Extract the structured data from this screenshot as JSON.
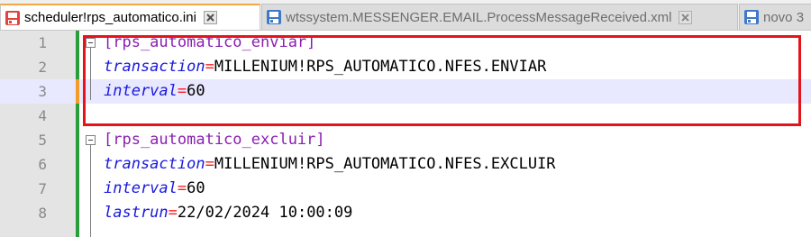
{
  "tabs": [
    {
      "label": "scheduler!rps_automatico.ini",
      "active": true,
      "icon": "document-modified-icon",
      "close_icon": "close-icon"
    },
    {
      "label": "wtssystem.MESSENGER.EMAIL.ProcessMessageReceived.xml",
      "active": false,
      "icon": "document-saved-icon",
      "close_icon": "close-icon"
    },
    {
      "label": "novo 3",
      "active": false,
      "icon": "document-saved-icon"
    }
  ],
  "editor": {
    "lines": [
      {
        "num": "1",
        "section": "[rps_automatico_enviar]"
      },
      {
        "num": "2",
        "key": "transaction",
        "op": "=",
        "value": "MILLENIUM!RPS_AUTOMATICO.NFES.ENVIAR"
      },
      {
        "num": "3",
        "key": "interval",
        "op": "=",
        "value": "60"
      },
      {
        "num": "4"
      },
      {
        "num": "5",
        "section": "[rps_automatico_excluir]"
      },
      {
        "num": "6",
        "key": "transaction",
        "op": "=",
        "value": "MILLENIUM!RPS_AUTOMATICO.NFES.EXCLUIR"
      },
      {
        "num": "7",
        "key": "interval",
        "op": "=",
        "value": "60"
      },
      {
        "num": "8",
        "key": "lastrun",
        "op": "=",
        "value": "22/02/2024 10:00:09"
      }
    ]
  },
  "colors": {
    "section": "#8b1fb0",
    "key": "#1818e0",
    "operator": "#ff1a1a",
    "highlight_box": "#e5141b",
    "current_line": "#e8e8ff",
    "saved_change_bar": "#2a9d3c",
    "unsaved_change_bar": "#f39c2a"
  }
}
